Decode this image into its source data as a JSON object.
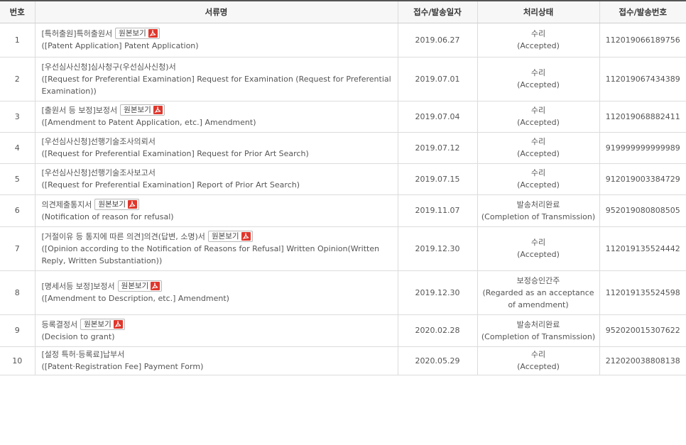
{
  "table": {
    "headers": [
      "번호",
      "서류명",
      "접수/발송일자",
      "처리상태",
      "접수/발송번호"
    ],
    "view_button_label": "원본보기",
    "rows": [
      {
        "no": "1",
        "doc_ko": "[특허출원]특허출원서",
        "doc_en": "([Patent Application] Patent Application)",
        "has_view": true,
        "date": "2019.06.27",
        "status_ko": "수리",
        "status_en": "(Accepted)",
        "number": "112019066189756"
      },
      {
        "no": "2",
        "doc_ko": "[우선심사신청]심사청구(우선심사신청)서",
        "doc_en": "([Request for Preferential Examination] Request for Examination (Request for Preferential Examination))",
        "has_view": false,
        "date": "2019.07.01",
        "status_ko": "수리",
        "status_en": "(Accepted)",
        "number": "112019067434389"
      },
      {
        "no": "3",
        "doc_ko": "[출원서 등 보정]보정서",
        "doc_en": "([Amendment to Patent Application, etc.] Amendment)",
        "has_view": true,
        "date": "2019.07.04",
        "status_ko": "수리",
        "status_en": "(Accepted)",
        "number": "112019068882411"
      },
      {
        "no": "4",
        "doc_ko": "[우선심사신청]선행기술조사의뢰서",
        "doc_en": "([Request for Preferential Examination] Request for Prior Art Search)",
        "has_view": false,
        "date": "2019.07.12",
        "status_ko": "수리",
        "status_en": "(Accepted)",
        "number": "919999999999989"
      },
      {
        "no": "5",
        "doc_ko": "[우선심사신청]선행기술조사보고서",
        "doc_en": "([Request for Preferential Examination] Report of Prior Art Search)",
        "has_view": false,
        "date": "2019.07.15",
        "status_ko": "수리",
        "status_en": "(Accepted)",
        "number": "912019003384729"
      },
      {
        "no": "6",
        "doc_ko": "의견제출통지서",
        "doc_en": "(Notification of reason for refusal)",
        "has_view": true,
        "date": "2019.11.07",
        "status_ko": "발송처리완료",
        "status_en": "(Completion of Transmission)",
        "number": "952019080808505"
      },
      {
        "no": "7",
        "doc_ko": "[거절이유 등 통지에 따른 의견]의견(답변, 소명)서",
        "doc_en": "([Opinion according to the Notification of Reasons for Refusal] Written Opinion(Written Reply, Written Substantiation))",
        "has_view": true,
        "date": "2019.12.30",
        "status_ko": "수리",
        "status_en": "(Accepted)",
        "number": "112019135524442"
      },
      {
        "no": "8",
        "doc_ko": "[명세서등 보정]보정서",
        "doc_en": "([Amendment to Description, etc.] Amendment)",
        "has_view": true,
        "date": "2019.12.30",
        "status_ko": "보정승인간주",
        "status_en": "(Regarded as an acceptance of amendment)",
        "number": "112019135524598"
      },
      {
        "no": "9",
        "doc_ko": "등록결정서",
        "doc_en": "(Decision to grant)",
        "has_view": true,
        "date": "2020.02.28",
        "status_ko": "발송처리완료",
        "status_en": "(Completion of Transmission)",
        "number": "952020015307622"
      },
      {
        "no": "10",
        "doc_ko": "[설정 특허·등록료]납부서",
        "doc_en": "([Patent·Registration Fee] Payment Form)",
        "has_view": false,
        "date": "2020.05.29",
        "status_ko": "수리",
        "status_en": "(Accepted)",
        "number": "212020038808138"
      }
    ]
  },
  "icons": {
    "view_button_icon": "pdf-icon"
  },
  "colors": {
    "header_rule": "#555555",
    "pdf_icon": "#e0362c",
    "grid": "#dcdcdc"
  }
}
